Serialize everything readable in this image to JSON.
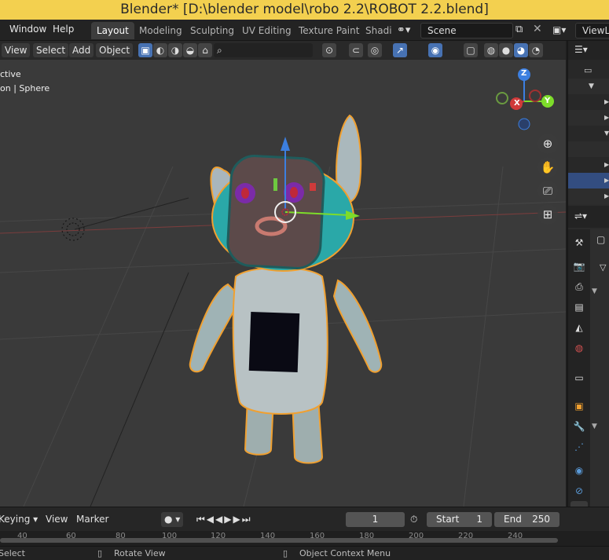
{
  "window": {
    "title": "Blender* [D:\\blender model\\robo 2.2\\ROBOT 2.2.blend]"
  },
  "menu": {
    "window": "Window",
    "help": "Help"
  },
  "workspaces": [
    "Layout",
    "Modeling",
    "Sculpting",
    "UV Editing",
    "Texture Paint",
    "Shadi"
  ],
  "scene": {
    "name": "Scene",
    "view_layer": "ViewLa"
  },
  "viewport_header": {
    "view": "View",
    "select": "Select",
    "add": "Add",
    "object": "Object"
  },
  "viewport_overlay": {
    "line1": "ctive",
    "line2": "on | Sphere"
  },
  "gizmo": {
    "x": "X",
    "y": "Y",
    "z": "Z"
  },
  "timeline": {
    "keying": "Keying",
    "view": "View",
    "marker": "Marker",
    "current_frame": "1",
    "start_label": "Start",
    "start_value": "1",
    "end_label": "End",
    "end_value": "250",
    "ruler": [
      "40",
      "60",
      "80",
      "100",
      "120",
      "140",
      "160",
      "180",
      "200",
      "220",
      "240"
    ]
  },
  "status": {
    "select": "Select",
    "rotate": "Rotate View",
    "context": "Object Context Menu"
  },
  "colors": {
    "title_bar": "#f3d04f",
    "selection_outline": "#f0a030",
    "active_blue": "#4772b3",
    "robot_teal": "#2aa8a8"
  },
  "icons": [
    "search-icon",
    "zoom-icon",
    "hand-icon",
    "camera-icon",
    "grid-icon",
    "scene-icon",
    "wrench-icon",
    "material-icon"
  ]
}
